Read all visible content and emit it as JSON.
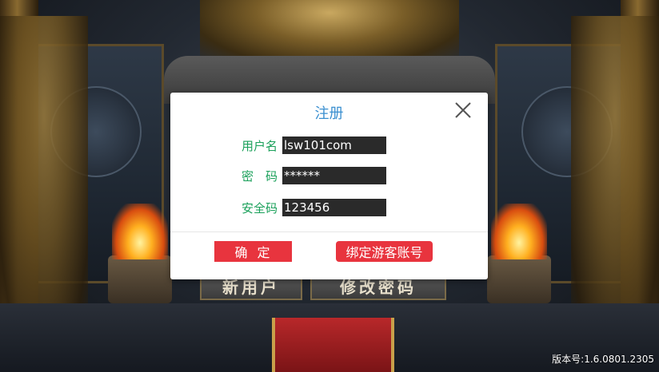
{
  "background": {
    "new_user_button": "新用户",
    "change_password_button": "修改密码",
    "version": "版本号:1.6.0801.2305"
  },
  "dialog": {
    "title": "注册",
    "close_icon": "close-icon",
    "fields": [
      {
        "label": "用户名",
        "value": "lsw101com"
      },
      {
        "label": "密　码",
        "value": "******"
      },
      {
        "label": "安全码",
        "value": "123456"
      }
    ],
    "confirm_label": "确定",
    "bind_guest_label": "绑定游客账号"
  },
  "colors": {
    "title": "#3a8fd0",
    "label": "#1aa05a",
    "field_bg": "#2a2a2a",
    "button": "#e8343e"
  }
}
